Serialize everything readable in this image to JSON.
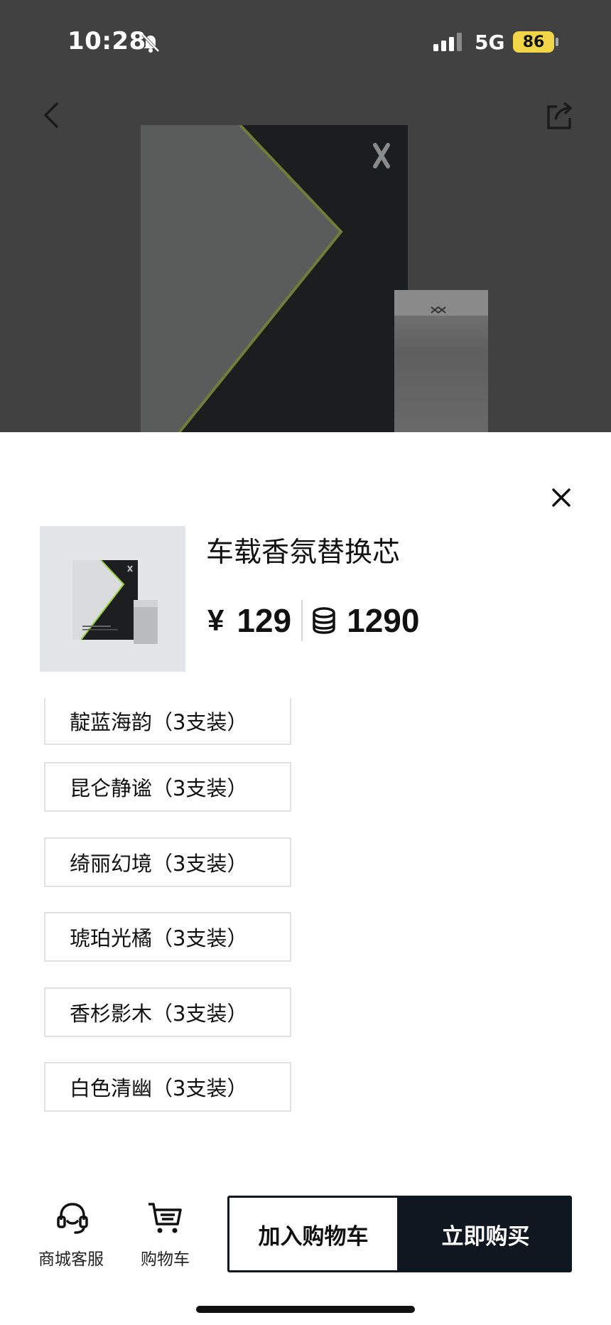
{
  "status_bar": {
    "time": "10:28",
    "network": "5G",
    "battery": "86",
    "icons": [
      "bell-muted-icon",
      "signal-icon",
      "battery-icon"
    ]
  },
  "header": {
    "icons": [
      "back-icon",
      "share-icon"
    ]
  },
  "product": {
    "title": "车载香氛替换芯",
    "currency_symbol": "¥",
    "price": "129",
    "points": "1290",
    "icons": [
      "close-icon",
      "coin-stack-icon"
    ]
  },
  "options": [
    {
      "label": "靛蓝海韵（3支装）"
    },
    {
      "label": "昆仑静谧（3支装）"
    },
    {
      "label": "绮丽幻境（3支装）"
    },
    {
      "label": "琥珀光橘（3支装）"
    },
    {
      "label": "香杉影木（3支装）"
    },
    {
      "label": "白色清幽（3支装）"
    }
  ],
  "bottom_bar": {
    "service_label": "商城客服",
    "cart_label": "购物车",
    "add_to_cart": "加入购物车",
    "buy_now": "立即购买",
    "icons": [
      "headset-icon",
      "cart-icon"
    ]
  },
  "colors": {
    "hero_overlay": "#414141",
    "primary_dark": "#0f1720",
    "battery": "#f3d648",
    "accent_green": "#9bd03a"
  }
}
